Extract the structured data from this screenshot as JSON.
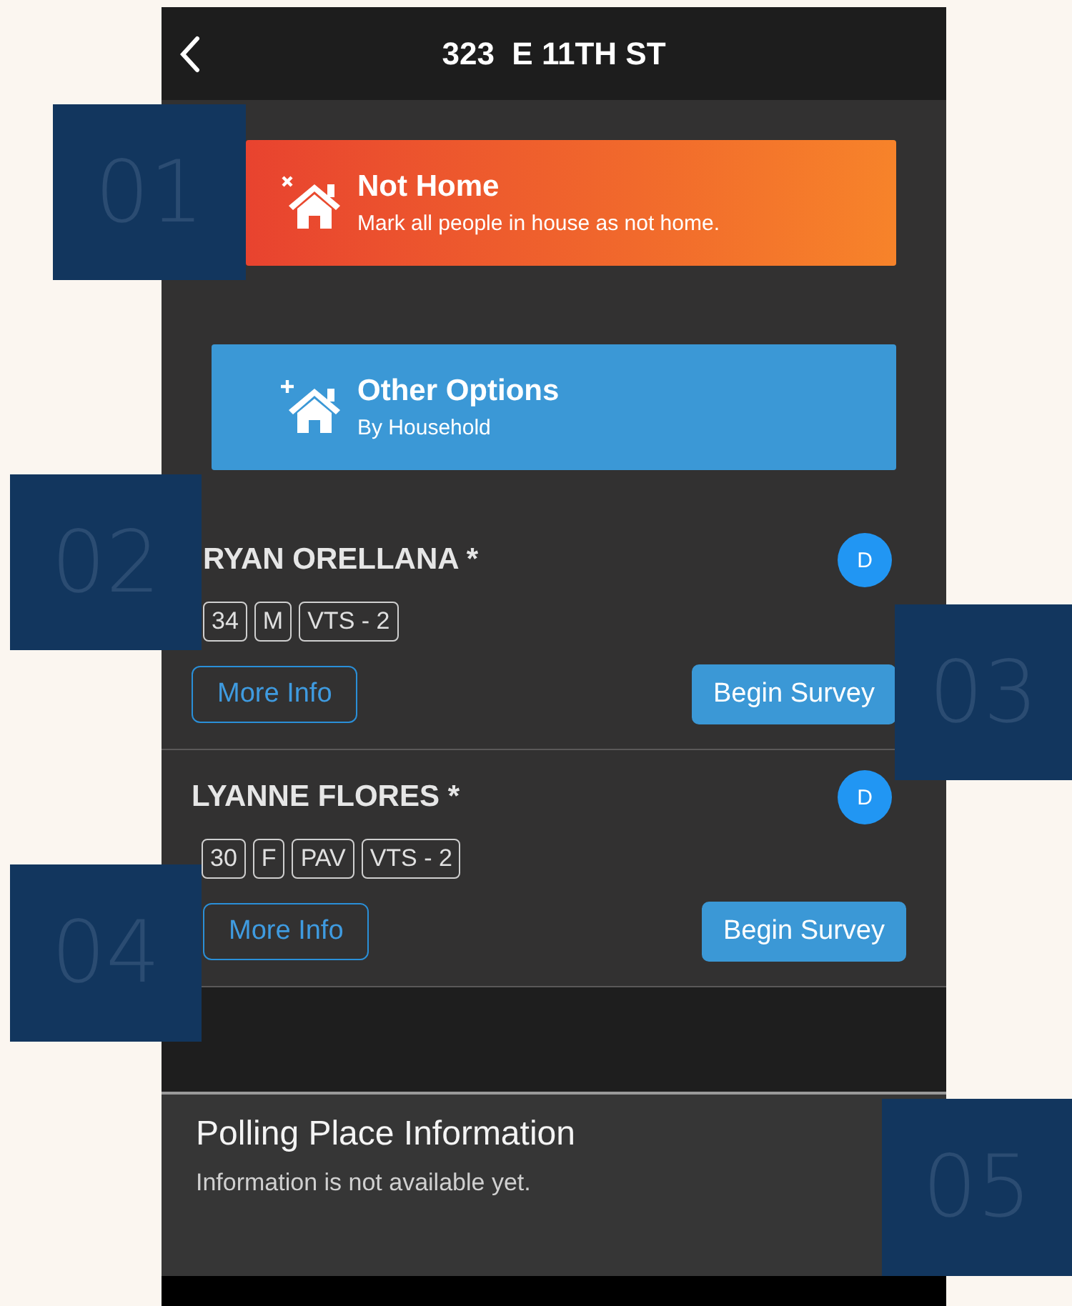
{
  "header": {
    "title": "323  E 11TH ST"
  },
  "household_actions": [
    {
      "kind": "not_home",
      "title": "Not Home",
      "subtitle": "Mark all people in house as not home."
    },
    {
      "kind": "other",
      "title": "Other Options",
      "subtitle": "By Household"
    }
  ],
  "people": [
    {
      "name": "RYAN ORELLANA *",
      "badge": "D",
      "tags": [
        "34",
        "M",
        "VTS - 2"
      ],
      "more_info": "More Info",
      "begin_survey": "Begin Survey"
    },
    {
      "name": "LYANNE FLORES *",
      "badge": "D",
      "tags": [
        "30",
        "F",
        "PAV",
        "VTS - 2"
      ],
      "more_info": "More Info",
      "begin_survey": "Begin Survey"
    }
  ],
  "polling_place": {
    "title": "Polling Place Information",
    "message": "Information is not available yet."
  },
  "callouts": [
    "01",
    "02",
    "03",
    "04",
    "05"
  ]
}
